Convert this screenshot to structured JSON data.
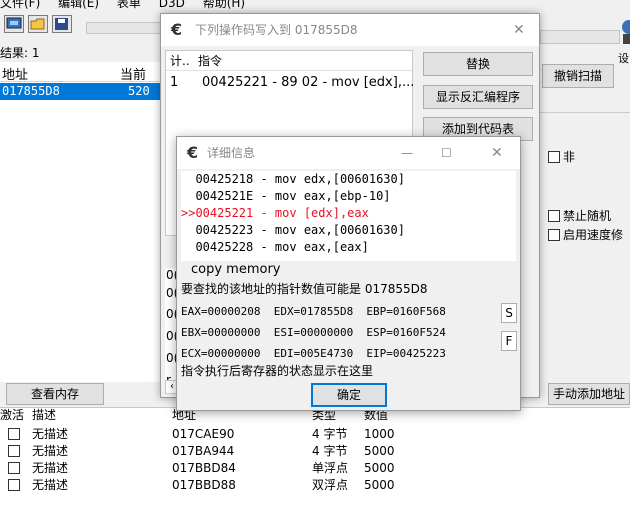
{
  "main": {
    "menu": [
      "文件(F)",
      "编辑(E)",
      "表单",
      "D3D",
      "帮助(H)"
    ],
    "results_label": "结果: 1",
    "list_headers": {
      "address": "地址",
      "current": "当前"
    },
    "selected_row": {
      "address": "017855D8",
      "value": "520"
    },
    "view_memory_button": "查看内存",
    "undo_scan_button": "撤销扫描",
    "settings_glyph": "设",
    "not_checkbox": "非",
    "disable_random_checkbox": "禁止随机",
    "speedhack_checkbox": "启用速度修",
    "add_address_button": "手动添加地址",
    "table_headers": {
      "active": "激活",
      "description": "描述",
      "address": "地址",
      "type": "类型",
      "value": "数值"
    },
    "table_rows": [
      {
        "description": "无描述",
        "address": "017CAE90",
        "type": "4 字节",
        "value": "1000"
      },
      {
        "description": "无描述",
        "address": "017BA944",
        "type": "4 字节",
        "value": "5000"
      },
      {
        "description": "无描述",
        "address": "017BBD84",
        "type": "单浮点",
        "value": "5000"
      },
      {
        "description": "无描述",
        "address": "017BBD88",
        "type": "双浮点",
        "value": "5000"
      }
    ]
  },
  "dialog1": {
    "title": "下列操作码写入到 017855D8",
    "close_glyph": "✕",
    "col_count": "计..",
    "col_instruction": "指令",
    "rows": [
      {
        "count": "1",
        "instruction": "00425221 - 89 02  - mov [edx],..."
      }
    ],
    "replace_button": "替换",
    "show_disasm_button": "显示反汇编程序",
    "add_to_codelist_button": "添加到代码表",
    "lower_fragments": [
      "0(",
      "0(",
      "0(",
      "0(",
      "0(",
      "r."
    ]
  },
  "dialog2": {
    "title": "详细信息",
    "minimize_glyph": "—",
    "maximize_glyph": "☐",
    "close_glyph": "✕",
    "asm_lines": [
      {
        "text": "  00425218 - mov edx,[00601630]",
        "highlight": false
      },
      {
        "text": "  0042521E - mov eax,[ebp-10]",
        "highlight": false
      },
      {
        "text": ">>00425221 - mov [edx],eax",
        "highlight": true
      },
      {
        "text": "  00425223 - mov eax,[00601630]",
        "highlight": false
      },
      {
        "text": "  00425228 - mov eax,[eax]",
        "highlight": false
      }
    ],
    "copy_memory": "copy memory",
    "pointer_hint": "要查找的该地址的指针数值可能是 017855D8",
    "registers": [
      "EAX=00000208  EDX=017855D8  EBP=0160F568",
      "EBX=00000000  ESI=00000000  ESP=0160F524",
      "ECX=00000000  EDI=005E4730  EIP=00425223"
    ],
    "s_button": "S",
    "f_button": "F",
    "footer_text": "指令执行后寄存器的状态显示在这里",
    "ok_button": "确定"
  },
  "colors": {
    "selection": "#0078d7",
    "highlight_red": "#e81123",
    "focus_border": "#0078d7"
  }
}
